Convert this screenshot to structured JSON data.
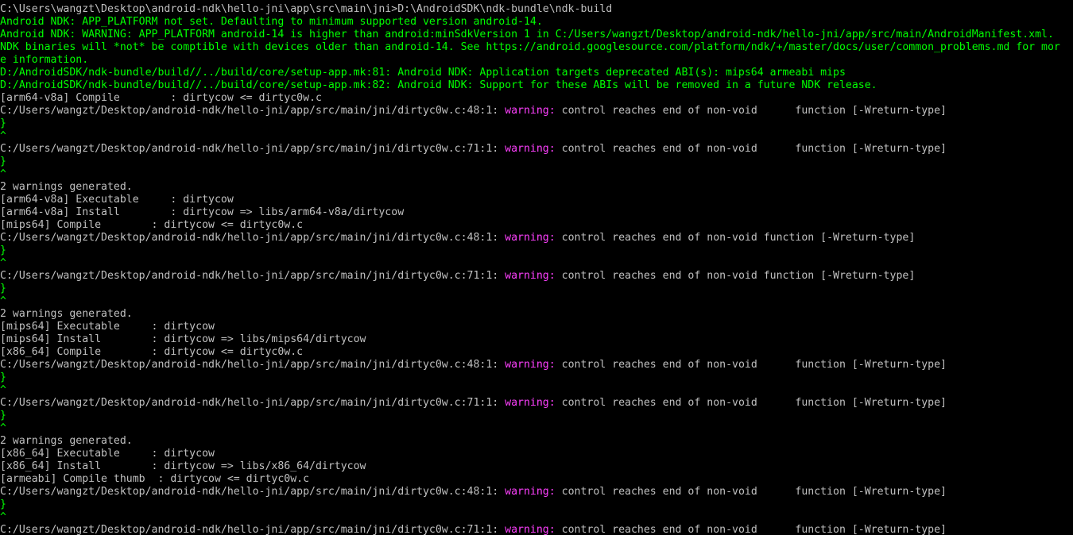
{
  "colors": {
    "background": "#000000",
    "stdout": "#c0c0c0",
    "ndk": "#00ff00",
    "warning": "#ff40ff"
  },
  "terminal": {
    "lines": [
      {
        "segments": [
          {
            "text": "C:\\Users\\wangzt\\Desktop\\android-ndk\\hello-jni\\app\\src\\main\\jni>D:\\AndroidSDK\\ndk-bundle\\ndk-build",
            "color": "#c0c0c0"
          }
        ]
      },
      {
        "segments": [
          {
            "text": "Android NDK: APP_PLATFORM not set. Defaulting to minimum supported version android-14.",
            "color": "#00ff00"
          }
        ]
      },
      {
        "segments": [
          {
            "text": "Android NDK: WARNING: APP_PLATFORM android-14 is higher than android:minSdkVersion 1 in C:/Users/wangzt/Desktop/android-ndk/hello-jni/app/src/main/AndroidManifest.xml.",
            "color": "#00ff00"
          }
        ]
      },
      {
        "segments": [
          {
            "text": "NDK binaries will *not* be comptible with devices older than android-14. See https://android.googlesource.com/platform/ndk/+/master/docs/user/common_problems.md for mor",
            "color": "#00ff00"
          }
        ]
      },
      {
        "segments": [
          {
            "text": "e information.",
            "color": "#00ff00"
          }
        ]
      },
      {
        "segments": [
          {
            "text": "D:/AndroidSDK/ndk-bundle/build//../build/core/setup-app.mk:81: Android NDK: Application targets deprecated ABI(s): mips64 armeabi mips",
            "color": "#00ff00"
          }
        ]
      },
      {
        "segments": [
          {
            "text": "D:/AndroidSDK/ndk-bundle/build//../build/core/setup-app.mk:82: Android NDK: Support for these ABIs will be removed in a future NDK release.",
            "color": "#00ff00"
          }
        ]
      },
      {
        "segments": [
          {
            "text": "[arm64-v8a] Compile        : dirtycow <= dirtyc0w.c",
            "color": "#c0c0c0"
          }
        ]
      },
      {
        "segments": [
          {
            "text": "C:/Users/wangzt/Desktop/android-ndk/hello-jni/app/src/main/jni/dirtyc0w.c:48:1: ",
            "color": "#c0c0c0"
          },
          {
            "text": "warning:",
            "color": "#ff40ff"
          },
          {
            "text": " control reaches end of non-void      function [-Wreturn-type]",
            "color": "#c0c0c0"
          }
        ]
      },
      {
        "segments": [
          {
            "text": "}",
            "color": "#00ff00"
          }
        ]
      },
      {
        "segments": [
          {
            "text": "^",
            "color": "#00ff00"
          }
        ]
      },
      {
        "segments": [
          {
            "text": "C:/Users/wangzt/Desktop/android-ndk/hello-jni/app/src/main/jni/dirtyc0w.c:71:1: ",
            "color": "#c0c0c0"
          },
          {
            "text": "warning:",
            "color": "#ff40ff"
          },
          {
            "text": " control reaches end of non-void      function [-Wreturn-type]",
            "color": "#c0c0c0"
          }
        ]
      },
      {
        "segments": [
          {
            "text": "}",
            "color": "#00ff00"
          }
        ]
      },
      {
        "segments": [
          {
            "text": "^",
            "color": "#00ff00"
          }
        ]
      },
      {
        "segments": [
          {
            "text": "2 warnings generated.",
            "color": "#c0c0c0"
          }
        ]
      },
      {
        "segments": [
          {
            "text": "[arm64-v8a] Executable     : dirtycow",
            "color": "#c0c0c0"
          }
        ]
      },
      {
        "segments": [
          {
            "text": "[arm64-v8a] Install        : dirtycow => libs/arm64-v8a/dirtycow",
            "color": "#c0c0c0"
          }
        ]
      },
      {
        "segments": [
          {
            "text": "[mips64] Compile        : dirtycow <= dirtyc0w.c",
            "color": "#c0c0c0"
          }
        ]
      },
      {
        "segments": [
          {
            "text": "C:/Users/wangzt/Desktop/android-ndk/hello-jni/app/src/main/jni/dirtyc0w.c:48:1: ",
            "color": "#c0c0c0"
          },
          {
            "text": "warning:",
            "color": "#ff40ff"
          },
          {
            "text": " control reaches end of non-void function [-Wreturn-type]",
            "color": "#c0c0c0"
          }
        ]
      },
      {
        "segments": [
          {
            "text": "}",
            "color": "#00ff00"
          }
        ]
      },
      {
        "segments": [
          {
            "text": "^",
            "color": "#00ff00"
          }
        ]
      },
      {
        "segments": [
          {
            "text": "C:/Users/wangzt/Desktop/android-ndk/hello-jni/app/src/main/jni/dirtyc0w.c:71:1: ",
            "color": "#c0c0c0"
          },
          {
            "text": "warning:",
            "color": "#ff40ff"
          },
          {
            "text": " control reaches end of non-void function [-Wreturn-type]",
            "color": "#c0c0c0"
          }
        ]
      },
      {
        "segments": [
          {
            "text": "}",
            "color": "#00ff00"
          }
        ]
      },
      {
        "segments": [
          {
            "text": "^",
            "color": "#00ff00"
          }
        ]
      },
      {
        "segments": [
          {
            "text": "2 warnings generated.",
            "color": "#c0c0c0"
          }
        ]
      },
      {
        "segments": [
          {
            "text": "[mips64] Executable     : dirtycow",
            "color": "#c0c0c0"
          }
        ]
      },
      {
        "segments": [
          {
            "text": "[mips64] Install        : dirtycow => libs/mips64/dirtycow",
            "color": "#c0c0c0"
          }
        ]
      },
      {
        "segments": [
          {
            "text": "[x86_64] Compile        : dirtycow <= dirtyc0w.c",
            "color": "#c0c0c0"
          }
        ]
      },
      {
        "segments": [
          {
            "text": "C:/Users/wangzt/Desktop/android-ndk/hello-jni/app/src/main/jni/dirtyc0w.c:48:1: ",
            "color": "#c0c0c0"
          },
          {
            "text": "warning:",
            "color": "#ff40ff"
          },
          {
            "text": " control reaches end of non-void      function [-Wreturn-type]",
            "color": "#c0c0c0"
          }
        ]
      },
      {
        "segments": [
          {
            "text": "}",
            "color": "#00ff00"
          }
        ]
      },
      {
        "segments": [
          {
            "text": "^",
            "color": "#00ff00"
          }
        ]
      },
      {
        "segments": [
          {
            "text": "C:/Users/wangzt/Desktop/android-ndk/hello-jni/app/src/main/jni/dirtyc0w.c:71:1: ",
            "color": "#c0c0c0"
          },
          {
            "text": "warning:",
            "color": "#ff40ff"
          },
          {
            "text": " control reaches end of non-void      function [-Wreturn-type]",
            "color": "#c0c0c0"
          }
        ]
      },
      {
        "segments": [
          {
            "text": "}",
            "color": "#00ff00"
          }
        ]
      },
      {
        "segments": [
          {
            "text": "^",
            "color": "#00ff00"
          }
        ]
      },
      {
        "segments": [
          {
            "text": "2 warnings generated.",
            "color": "#c0c0c0"
          }
        ]
      },
      {
        "segments": [
          {
            "text": "[x86_64] Executable     : dirtycow",
            "color": "#c0c0c0"
          }
        ]
      },
      {
        "segments": [
          {
            "text": "[x86_64] Install        : dirtycow => libs/x86_64/dirtycow",
            "color": "#c0c0c0"
          }
        ]
      },
      {
        "segments": [
          {
            "text": "[armeabi] Compile thumb  : dirtycow <= dirtyc0w.c",
            "color": "#c0c0c0"
          }
        ]
      },
      {
        "segments": [
          {
            "text": "C:/Users/wangzt/Desktop/android-ndk/hello-jni/app/src/main/jni/dirtyc0w.c:48:1: ",
            "color": "#c0c0c0"
          },
          {
            "text": "warning:",
            "color": "#ff40ff"
          },
          {
            "text": " control reaches end of non-void      function [-Wreturn-type]",
            "color": "#c0c0c0"
          }
        ]
      },
      {
        "segments": [
          {
            "text": "}",
            "color": "#00ff00"
          }
        ]
      },
      {
        "segments": [
          {
            "text": "^",
            "color": "#00ff00"
          }
        ]
      },
      {
        "segments": [
          {
            "text": "C:/Users/wangzt/Desktop/android-ndk/hello-jni/app/src/main/jni/dirtyc0w.c:71:1: ",
            "color": "#c0c0c0"
          },
          {
            "text": "warning:",
            "color": "#ff40ff"
          },
          {
            "text": " control reaches end of non-void      function [-Wreturn-type]",
            "color": "#c0c0c0"
          }
        ]
      }
    ]
  }
}
